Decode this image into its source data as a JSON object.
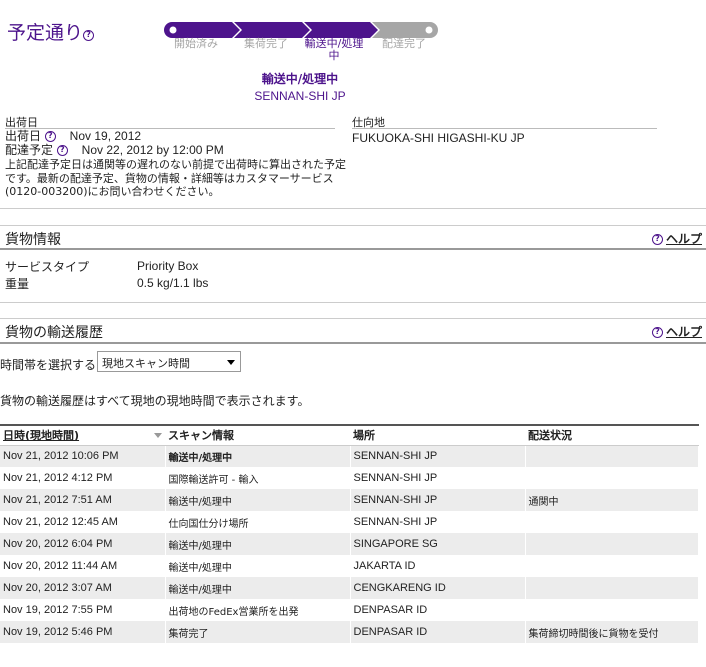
{
  "status": {
    "title": "予定通り",
    "help": "?",
    "steps": [
      "開始済み",
      "集荷完了",
      "輸送中/処理中",
      "配達完了"
    ],
    "current_status": "輸送中/処理中",
    "current_location": "SENNAN-SHI JP"
  },
  "shipment": {
    "origin_header": "出荷日",
    "destination_header": "仕向地",
    "ship_date_label": "出荷日",
    "ship_date": "Nov 19, 2012",
    "delivery_label": "配達予定",
    "delivery_date": "Nov 22, 2012 by 12:00 PM",
    "note": "上記配達予定日は通関等の遅れのない前提で出荷時に算出された予定です。最新の配達予定、貨物の情報・詳細等はカスタマーサービス(0120-003200)にお問い合わせください。",
    "destination": "FUKUOKA-SHI HIGASHI-KU JP"
  },
  "cargo_info": {
    "title": "貨物情報",
    "help_label": "ヘルプ",
    "service_type_label": "サービスタイプ",
    "service_type": "Priority Box",
    "weight_label": "重量",
    "weight": "0.5 kg/1.1 lbs"
  },
  "history": {
    "title": "貨物の輸送履歴",
    "help_label": "ヘルプ",
    "timezone_label": "時間帯を選択する:",
    "timezone_value": "現地スキャン時間",
    "note": "貨物の輸送履歴はすべて現地の現地時間で表示されます。",
    "columns": [
      "日時(現地時間)",
      "スキャン情報",
      "場所",
      "配送状況"
    ],
    "rows": [
      {
        "datetime": "Nov 21, 2012 10:06 PM",
        "scan": "輸送中/処理中",
        "location": "SENNAN-SHI JP",
        "status": ""
      },
      {
        "datetime": "Nov 21, 2012 4:12 PM",
        "scan": "国際輸送許可 - 輸入",
        "location": "SENNAN-SHI JP",
        "status": ""
      },
      {
        "datetime": "Nov 21, 2012 7:51 AM",
        "scan": "輸送中/処理中",
        "location": "SENNAN-SHI JP",
        "status": "通関中"
      },
      {
        "datetime": "Nov 21, 2012 12:45 AM",
        "scan": "仕向国仕分け場所",
        "location": "SENNAN-SHI JP",
        "status": ""
      },
      {
        "datetime": "Nov 20, 2012 6:04 PM",
        "scan": "輸送中/処理中",
        "location": "SINGAPORE SG",
        "status": ""
      },
      {
        "datetime": "Nov 20, 2012 11:44 AM",
        "scan": "輸送中/処理中",
        "location": "JAKARTA ID",
        "status": ""
      },
      {
        "datetime": "Nov 20, 2012 3:07 AM",
        "scan": "輸送中/処理中",
        "location": "CENGKARENG ID",
        "status": ""
      },
      {
        "datetime": "Nov 19, 2012 7:55 PM",
        "scan": "出荷地のFedEx営業所を出発",
        "location": "DENPASAR ID",
        "status": ""
      },
      {
        "datetime": "Nov 19, 2012 5:46 PM",
        "scan": "集荷完了",
        "location": "DENPASAR ID",
        "status": "集荷締切時間後に貨物を受付"
      }
    ]
  },
  "colors": {
    "purple": "#4d148c",
    "grey": "#a6a6a6"
  }
}
